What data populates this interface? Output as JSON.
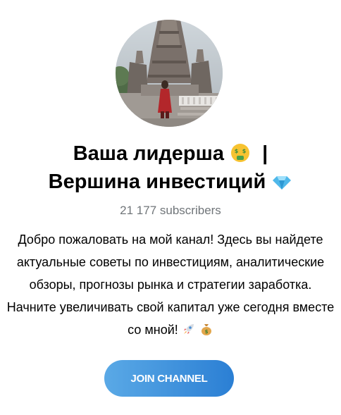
{
  "channel": {
    "avatar_icon": "channel-avatar-photo",
    "title_line1": "Ваша лидерша",
    "title_separator": "|",
    "title_line2": "Вершина инвестиций",
    "title_emoji_1": "money-mouth-face-emoji",
    "title_emoji_2": "gem-stone-emoji",
    "subscribers": "21 177 subscribers",
    "description": "Добро пожаловать на мой канал! Здесь вы найдете актуальные советы по инвестициям, аналитические обзоры, прогнозы рынка и стратегии заработка. Начните увеличивать свой капитал уже сегодня вместе со мной!",
    "description_emoji_1": "rocket-emoji",
    "description_emoji_2": "money-bag-emoji"
  },
  "actions": {
    "join_label": "JOIN CHANNEL"
  },
  "colors": {
    "accent_start": "#5aa9e6",
    "accent_end": "#2b7fd4",
    "secondary_text": "#707579"
  }
}
